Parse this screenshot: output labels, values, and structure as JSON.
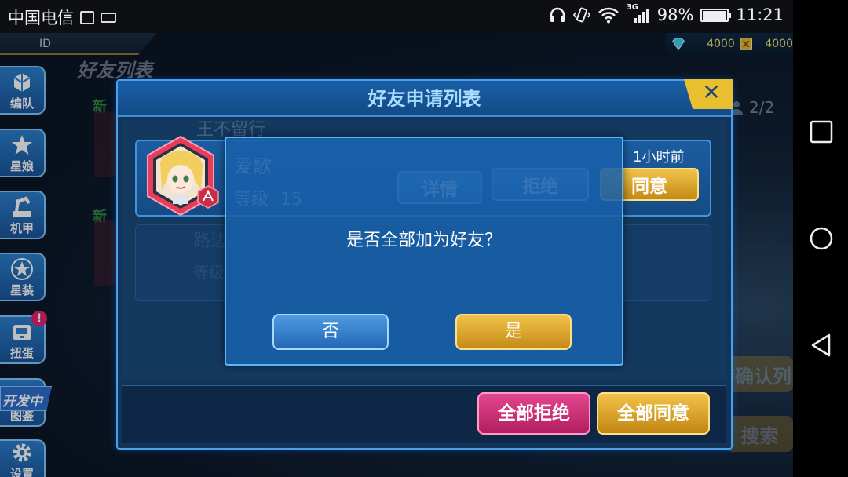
{
  "status_bar": {
    "carrier": "中国电信",
    "network": "3G",
    "battery": "98%",
    "battery_fraction": 0.98,
    "time": "11:21"
  },
  "game": {
    "top_bar_text": "ID",
    "currency": {
      "gem": "4000",
      "coin": "4000"
    },
    "screen_title": "好友列表",
    "friend_count_label": "2/2",
    "bg_pending_button": "待确认列",
    "bg_search_button": "搜索",
    "bg_new_tag": "新",
    "dev_badge": "开发中",
    "notification": "!"
  },
  "side_menu": [
    {
      "label": "编队",
      "icon": "formation-icon"
    },
    {
      "label": "星娘",
      "icon": "star-girl-icon"
    },
    {
      "label": "机甲",
      "icon": "mech-icon"
    },
    {
      "label": "星装",
      "icon": "star-gear-icon"
    },
    {
      "label": "扭蛋",
      "icon": "gacha-icon"
    },
    {
      "label": "图鉴",
      "icon": "codex-icon"
    },
    {
      "label": "设置",
      "icon": "settings-icon"
    }
  ],
  "dialog": {
    "title": "好友申请列表",
    "close": "✕",
    "requests": [
      {
        "name": "爱歌",
        "level_label": "等级",
        "level": "15",
        "time": "1小时前",
        "detail": "详情",
        "reject": "拒绝",
        "accept": "同意"
      }
    ],
    "bg_names": [
      "王不留行",
      "路边"
    ],
    "bg_level_label": "等级",
    "reject_all": "全部拒绝",
    "accept_all": "全部同意"
  },
  "confirm": {
    "message": "是否全部加为好友？",
    "no": "否",
    "yes": "是"
  },
  "colors": {
    "panel": "#12335a",
    "accent_gold": "#f0c34a",
    "accent_pink": "#e3478f",
    "accent_blue": "#2c80cf"
  }
}
